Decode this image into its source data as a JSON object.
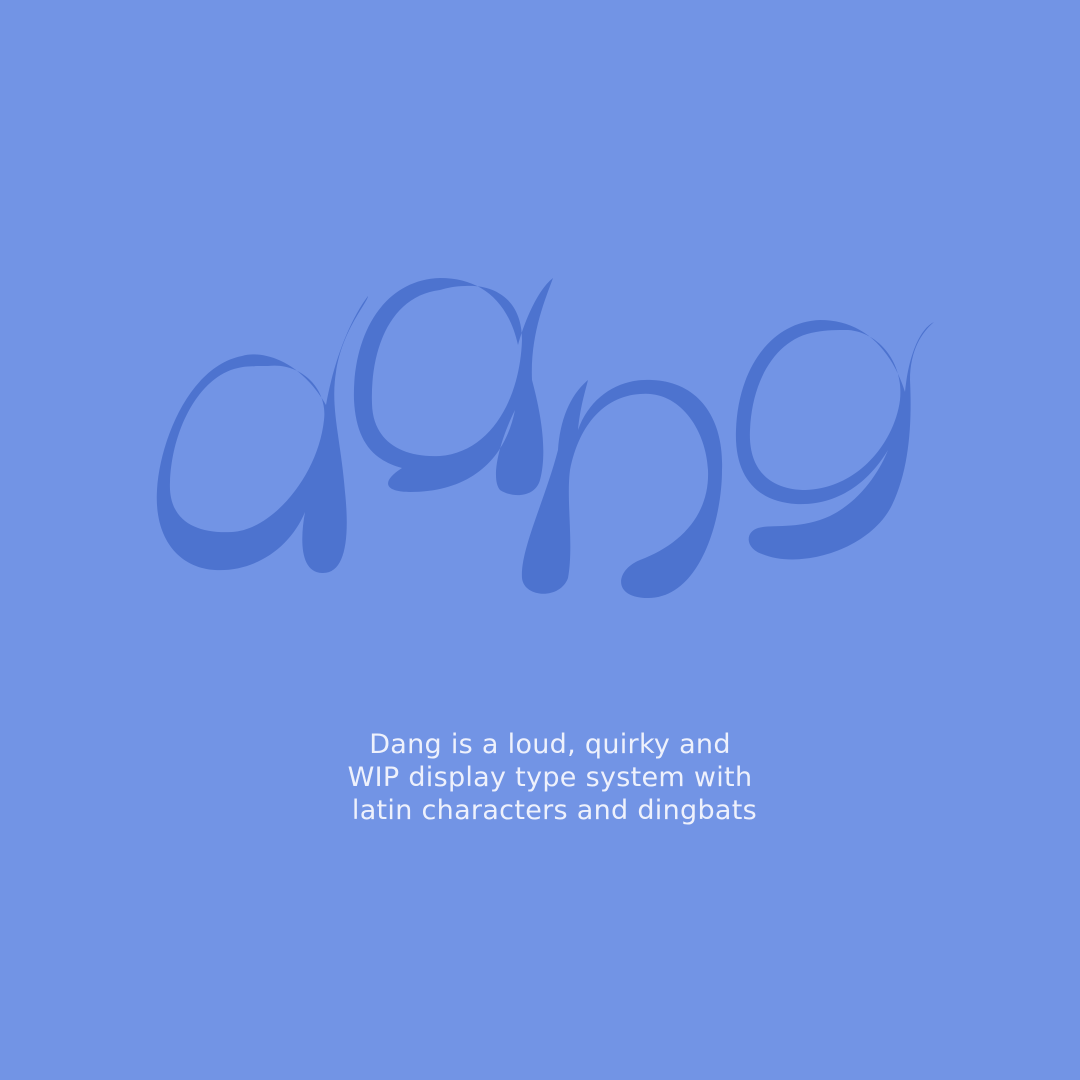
{
  "colors": {
    "background": "#7294e5",
    "logo": "#4d73cf",
    "text": "#eef1fc"
  },
  "logo": {
    "wordmark": "dang"
  },
  "description": {
    "lines": [
      "Dang is a loud, quirky and",
      "WIP display type system with",
      " latin characters and dingbats"
    ]
  }
}
